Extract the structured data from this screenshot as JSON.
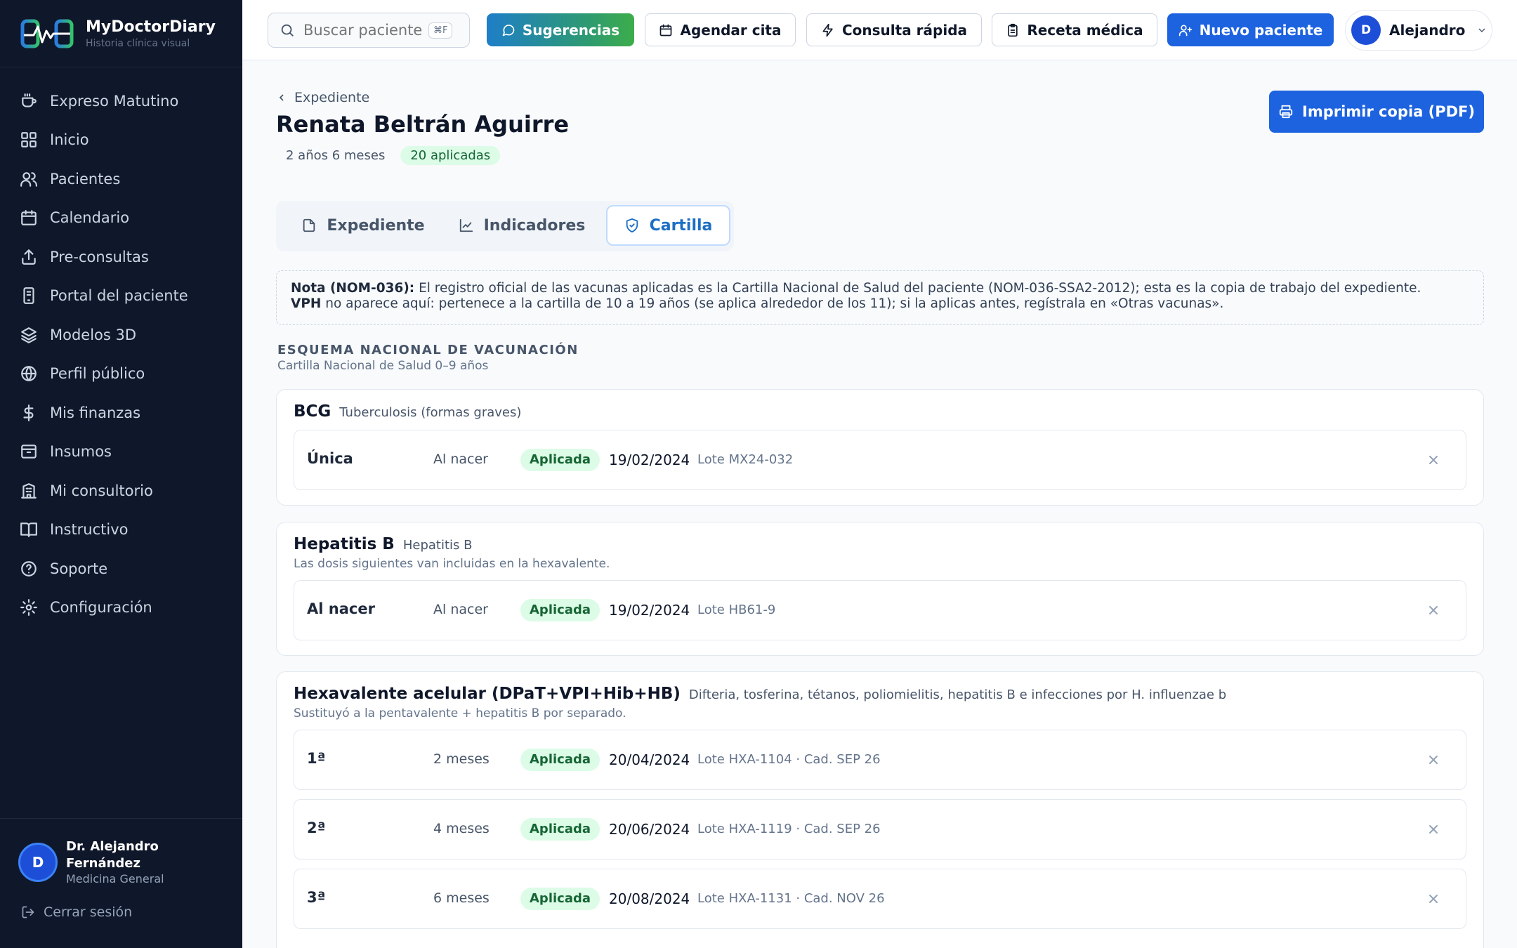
{
  "brand": {
    "name": "MyDoctorDiary",
    "tagline": "Historia clínica visual"
  },
  "sidebar": {
    "items": [
      {
        "label": "Expreso Matutino",
        "icon": "coffee-icon"
      },
      {
        "label": "Inicio",
        "icon": "grid-icon"
      },
      {
        "label": "Pacientes",
        "icon": "users-icon"
      },
      {
        "label": "Calendario",
        "icon": "calendar-icon"
      },
      {
        "label": "Pre-consultas",
        "icon": "upload-icon"
      },
      {
        "label": "Portal del paciente",
        "icon": "tablet-icon"
      },
      {
        "label": "Modelos 3D",
        "icon": "layers-icon"
      },
      {
        "label": "Perfil público",
        "icon": "globe-icon"
      },
      {
        "label": "Mis finanzas",
        "icon": "dollar-icon"
      },
      {
        "label": "Insumos",
        "icon": "archive-icon"
      },
      {
        "label": "Mi consultorio",
        "icon": "building-icon"
      },
      {
        "label": "Instructivo",
        "icon": "book-icon"
      },
      {
        "label": "Soporte",
        "icon": "help-circle-icon"
      },
      {
        "label": "Configuración",
        "icon": "gear-icon"
      }
    ],
    "user": {
      "initial": "D",
      "name": "Dr. Alejandro Fernández",
      "role": "Medicina General"
    },
    "logout": "Cerrar sesión"
  },
  "topbar": {
    "search_placeholder": "Buscar paciente",
    "search_shortcut": "⌘F",
    "buttons": {
      "sugerencias": "Sugerencias",
      "agendar": "Agendar cita",
      "rapida": "Consulta rápida",
      "receta": "Receta médica",
      "nuevo": "Nuevo paciente"
    },
    "profile": {
      "initial": "D",
      "name": "Alejandro"
    }
  },
  "patient": {
    "breadcrumb": "Expediente",
    "name": "Renata Beltrán Aguirre",
    "age": "2 años 6 meses",
    "applied_badge": "20 aplicadas",
    "print_button": "Imprimir copia (PDF)"
  },
  "tabs": [
    {
      "label": "Expediente",
      "active": false
    },
    {
      "label": "Indicadores",
      "active": false
    },
    {
      "label": "Cartilla",
      "active": true
    }
  ],
  "note": {
    "bold1": "Nota (NOM-036):",
    "text1": " El registro oficial de las vacunas aplicadas es la Cartilla Nacional de Salud del paciente (NOM-036-SSA2-2012); esta es la copia de trabajo del expediente.",
    "bold2": "VPH",
    "text2": " no aparece aquí: pertenece a la cartilla de 10 a 19 años (se aplica alrededor de los 11); si la aplicas antes, regístrala en «Otras vacunas»."
  },
  "schedule": {
    "title": "ESQUEMA NACIONAL DE VACUNACIÓN",
    "subtitle": "Cartilla Nacional de Salud 0–9 años",
    "vaccines": [
      {
        "name": "BCG",
        "description": "Tuberculosis (formas graves)",
        "note": "",
        "doses": [
          {
            "label": "Única",
            "age": "Al nacer",
            "status": "Aplicada",
            "date": "19/02/2024",
            "lot": "Lote MX24-032"
          }
        ]
      },
      {
        "name": "Hepatitis B",
        "description": "Hepatitis B",
        "note": "Las dosis siguientes van incluidas en la hexavalente.",
        "doses": [
          {
            "label": "Al nacer",
            "age": "Al nacer",
            "status": "Aplicada",
            "date": "19/02/2024",
            "lot": "Lote HB61-9"
          }
        ]
      },
      {
        "name": "Hexavalente acelular (DPaT+VPI+Hib+HB)",
        "description": "Difteria, tosferina, tétanos, poliomielitis, hepatitis B e infecciones por H. influenzae b",
        "note": "Sustituyó a la pentavalente + hepatitis B por separado.",
        "doses": [
          {
            "label": "1ª",
            "age": "2 meses",
            "status": "Aplicada",
            "date": "20/04/2024",
            "lot": "Lote HXA-1104 · Cad. SEP 26"
          },
          {
            "label": "2ª",
            "age": "4 meses",
            "status": "Aplicada",
            "date": "20/06/2024",
            "lot": "Lote HXA-1119 · Cad. SEP 26"
          },
          {
            "label": "3ª",
            "age": "6 meses",
            "status": "Aplicada",
            "date": "20/08/2024",
            "lot": "Lote HXA-1131 · Cad. NOV 26"
          }
        ]
      }
    ]
  },
  "colors": {
    "sidebar_bg": "#0f172a",
    "primary": "#1d63e0",
    "applied_bg": "#dcfce7",
    "applied_text": "#166534",
    "active_tab": "#1d6fc4"
  }
}
